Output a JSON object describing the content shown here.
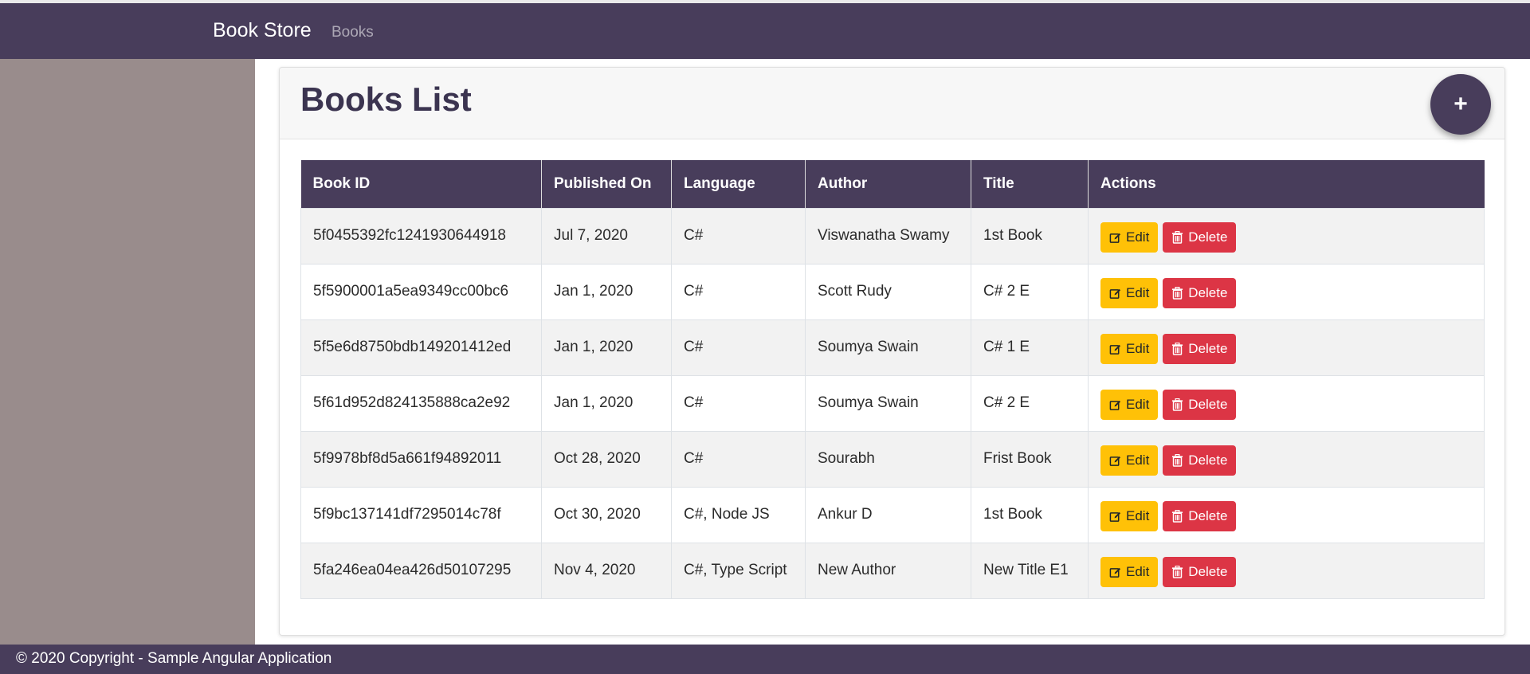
{
  "nav": {
    "brand": "Book Store",
    "link": "Books"
  },
  "page": {
    "title": "Books List",
    "add_label": "+"
  },
  "table": {
    "headers": [
      "Book ID",
      "Published On",
      "Language",
      "Author",
      "Title",
      "Actions"
    ],
    "rows": [
      {
        "id": "5f0455392fc1241930644918",
        "published": "Jul 7, 2020",
        "language": "C#",
        "author": "Viswanatha Swamy",
        "title": "1st Book"
      },
      {
        "id": "5f5900001a5ea9349cc00bc6",
        "published": "Jan 1, 2020",
        "language": "C#",
        "author": "Scott Rudy",
        "title": "C# 2 E"
      },
      {
        "id": "5f5e6d8750bdb149201412ed",
        "published": "Jan 1, 2020",
        "language": "C#",
        "author": "Soumya Swain",
        "title": "C# 1 E"
      },
      {
        "id": "5f61d952d824135888ca2e92",
        "published": "Jan 1, 2020",
        "language": "C#",
        "author": "Soumya Swain",
        "title": "C# 2 E"
      },
      {
        "id": "5f9978bf8d5a661f94892011",
        "published": "Oct 28, 2020",
        "language": "C#",
        "author": "Sourabh",
        "title": "Frist Book"
      },
      {
        "id": "5f9bc137141df7295014c78f",
        "published": "Oct 30, 2020",
        "language": "C#, Node JS",
        "author": "Ankur D",
        "title": "1st Book"
      },
      {
        "id": "5fa246ea04ea426d50107295",
        "published": "Nov 4, 2020",
        "language": "C#, Type Script",
        "author": "New Author",
        "title": "New Title E1"
      }
    ],
    "edit_label": "Edit",
    "delete_label": "Delete"
  },
  "footer": {
    "text": "© 2020 Copyright - Sample Angular Application"
  },
  "colors": {
    "primary": "#483d5b",
    "sidebar": "#998c8c",
    "edit": "#ffc107",
    "delete": "#dc3545"
  },
  "icons": {
    "edit": "pencil-square-icon",
    "delete": "trash-icon"
  }
}
